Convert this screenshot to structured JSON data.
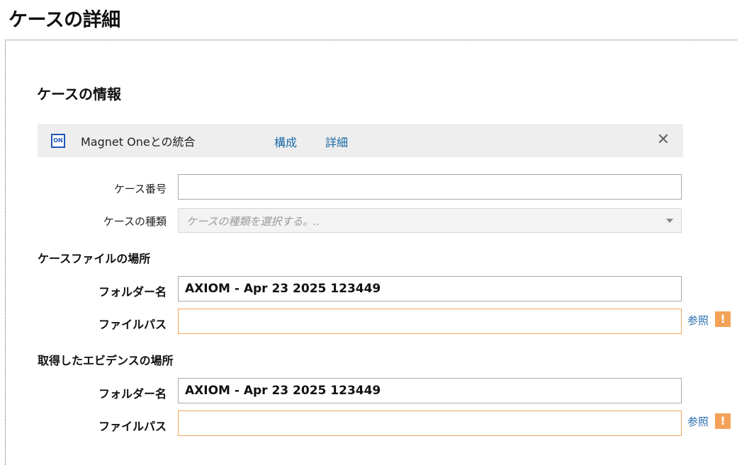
{
  "page": {
    "title": "ケースの詳細"
  },
  "case_info": {
    "title": "ケースの情報",
    "integration": {
      "icon": "magnet-one-icon",
      "icon_text": "ON",
      "label": "Magnet Oneとの統合",
      "configure_link": "構成",
      "details_link": "詳細",
      "close_glyph": "✕"
    },
    "case_number": {
      "label": "ケース番号",
      "value": ""
    },
    "case_type": {
      "label": "ケースの種類",
      "placeholder": "ケースの種類を選択する。.."
    }
  },
  "case_file_location": {
    "title": "ケースファイルの場所",
    "folder_name_label": "フォルダー名",
    "folder_name_value": "AXIOM - Apr 23 2025 123449",
    "file_path_label": "ファイルパス",
    "file_path_value": "",
    "browse_label": "参照",
    "warning_glyph": "!"
  },
  "evidence_location": {
    "title": "取得したエビデンスの場所",
    "folder_name_label": "フォルダー名",
    "folder_name_value": "AXIOM - Apr 23 2025 123449",
    "file_path_label": "ファイルパス",
    "file_path_value": "",
    "browse_label": "参照",
    "warning_glyph": "!"
  },
  "colors": {
    "link": "#1a6aa6",
    "warning_border": "#f3a55a",
    "warning_icon": "#f4a259",
    "integration_bg": "#eeeeee"
  }
}
